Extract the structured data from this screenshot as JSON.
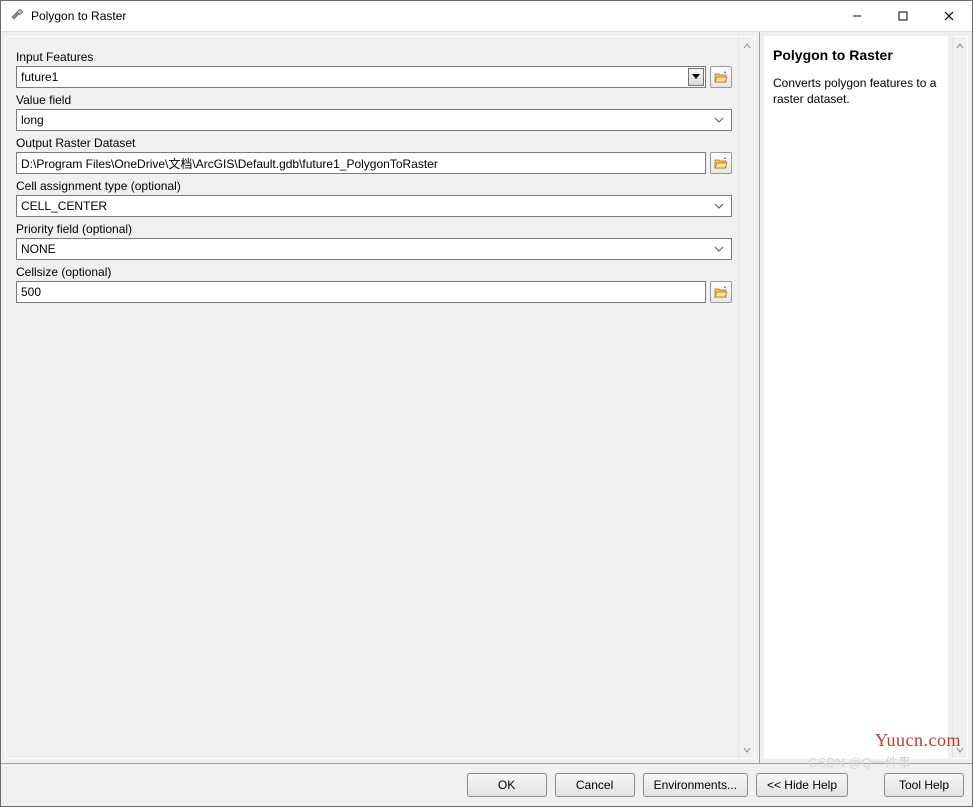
{
  "window": {
    "title": "Polygon to Raster"
  },
  "fields": {
    "input_features": {
      "label": "Input Features",
      "value": "future1"
    },
    "value_field": {
      "label": "Value field",
      "value": "long"
    },
    "output_raster": {
      "label": "Output Raster Dataset",
      "value": "D:\\Program Files\\OneDrive\\文档\\ArcGIS\\Default.gdb\\future1_PolygonToRaster"
    },
    "cell_assignment": {
      "label": "Cell assignment type (optional)",
      "value": "CELL_CENTER"
    },
    "priority_field": {
      "label": "Priority field (optional)",
      "value": "NONE"
    },
    "cellsize": {
      "label": "Cellsize (optional)",
      "value": "500"
    }
  },
  "help": {
    "title": "Polygon to Raster",
    "text": "Converts polygon features to a raster dataset."
  },
  "buttons": {
    "ok": "OK",
    "cancel": "Cancel",
    "environments": "Environments...",
    "hide_help": "<< Hide Help",
    "tool_help": "Tool Help"
  },
  "watermarks": {
    "site": "Yuucn.com",
    "csdn": "CSDN @Q一件事"
  }
}
